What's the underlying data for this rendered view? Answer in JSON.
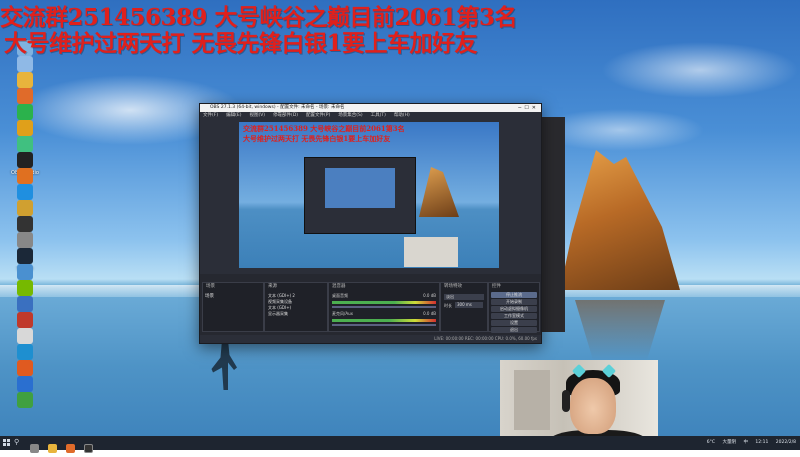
{
  "overlay": {
    "line1": "交流群251456389 大号峡谷之巅目前2061第3名",
    "line2": "大号维护过两天打 无畏先锋白银1要上车加好友"
  },
  "desktop_icons": [
    {
      "label": "",
      "icon": "recycle-bin-icon",
      "color": "#7fb2e0"
    },
    {
      "label": "",
      "icon": "computer-icon",
      "color": "#8fb9e6"
    },
    {
      "label": "",
      "icon": "folder-icon",
      "color": "#e8b43c"
    },
    {
      "label": "",
      "icon": "app-icon",
      "color": "#e06b2a"
    },
    {
      "label": "",
      "icon": "wechat-icon",
      "color": "#2bb24c"
    },
    {
      "label": "",
      "icon": "app-icon",
      "color": "#e0a01a"
    },
    {
      "label": "",
      "icon": "app-icon",
      "color": "#40c080"
    },
    {
      "label": "OBS Studio",
      "icon": "obs-icon",
      "color": "#222"
    },
    {
      "label": "",
      "icon": "app-icon",
      "color": "#e07020"
    },
    {
      "label": "",
      "icon": "qq-icon",
      "color": "#1f8fe0"
    },
    {
      "label": "",
      "icon": "app-icon",
      "color": "#d0a030"
    },
    {
      "label": "",
      "icon": "app-icon",
      "color": "#333"
    },
    {
      "label": "",
      "icon": "app-icon",
      "color": "#888"
    },
    {
      "label": "Steam",
      "icon": "steam-icon",
      "color": "#1b2838"
    },
    {
      "label": "",
      "icon": "app-icon",
      "color": "#4a90d0"
    },
    {
      "label": "",
      "icon": "nvidia-icon",
      "color": "#76b900"
    },
    {
      "label": "",
      "icon": "app-icon",
      "color": "#3a70c0"
    },
    {
      "label": "",
      "icon": "app-icon",
      "color": "#c0392b"
    },
    {
      "label": "",
      "icon": "app-icon",
      "color": "#d8d8d8"
    },
    {
      "label": "",
      "icon": "edge-icon",
      "color": "#1e8fd0"
    },
    {
      "label": "",
      "icon": "app-icon",
      "color": "#e05a20"
    },
    {
      "label": "",
      "icon": "shield-icon",
      "color": "#2a6fd0"
    },
    {
      "label": "",
      "icon": "app-icon",
      "color": "#40a040"
    }
  ],
  "obs": {
    "title": "OBS 27.1.3 (64-bit, windows) - 配置文件: 未命名 - 场景: 未命名",
    "menu": [
      "文件(F)",
      "编辑(E)",
      "视图(V)",
      "停靠部件(D)",
      "配置文件(P)",
      "场景集合(S)",
      "工具(T)",
      "帮助(H)"
    ],
    "preview_label": "",
    "docks": {
      "scenes": {
        "title": "场景",
        "items": [
          "场景"
        ]
      },
      "sources": {
        "title": "来源",
        "items": [
          "文本 (GDI+) 2",
          "视频采集设备",
          "文本 (GDI+)",
          "显示器采集"
        ]
      },
      "mixer": {
        "title": "混音器",
        "tracks": [
          {
            "name": "桌面音频",
            "level": "0.0 dB"
          },
          {
            "name": "麦克风/Aux",
            "level": "0.0 dB"
          }
        ]
      },
      "transitions": {
        "title": "转场特效",
        "fade": "淡出",
        "duration_label": "时长",
        "duration": "300 ms"
      },
      "controls": {
        "title": "控件",
        "buttons": [
          "停止推流",
          "开始录制",
          "启动虚拟摄像机",
          "工作室模式",
          "设置",
          "退出"
        ]
      }
    },
    "status": "LIVE: 00:00:00  REC: 00:00:00  CPU: 0.0%, 60.00 fps"
  },
  "taskbar": {
    "search_icon": "search-icon",
    "tray_temp": "6°C",
    "tray_weather": "大量阴",
    "tray_lang": "中",
    "time": "12:11",
    "date": "2022/2/8"
  }
}
